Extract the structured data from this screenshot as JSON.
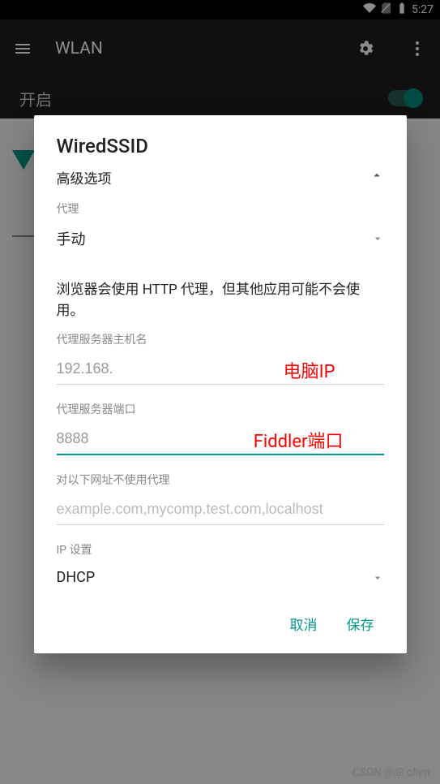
{
  "status": {
    "time": "5:27"
  },
  "appbar": {
    "title": "WLAN"
  },
  "bg": {
    "toggle_label": "开启"
  },
  "dialog": {
    "title": "WiredSSID",
    "advanced_label": "高级选项",
    "proxy_label": "代理",
    "proxy_value": "手动",
    "info_text": "浏览器会使用 HTTP 代理，但其他应用可能不会使用。",
    "hostname_label": "代理服务器主机名",
    "hostname_value": "192.168.",
    "hostname_annot": "电脑IP",
    "port_label": "代理服务器端口",
    "port_value": "8888",
    "port_annot": "Fiddler端口",
    "bypass_label": "对以下网址不使用代理",
    "bypass_placeholder": "example.com,mycomp.test.com,localhost",
    "ip_label": "IP 设置",
    "ip_value": "DHCP",
    "cancel": "取消",
    "save": "保存"
  },
  "watermark": "CSDN @@ chen"
}
